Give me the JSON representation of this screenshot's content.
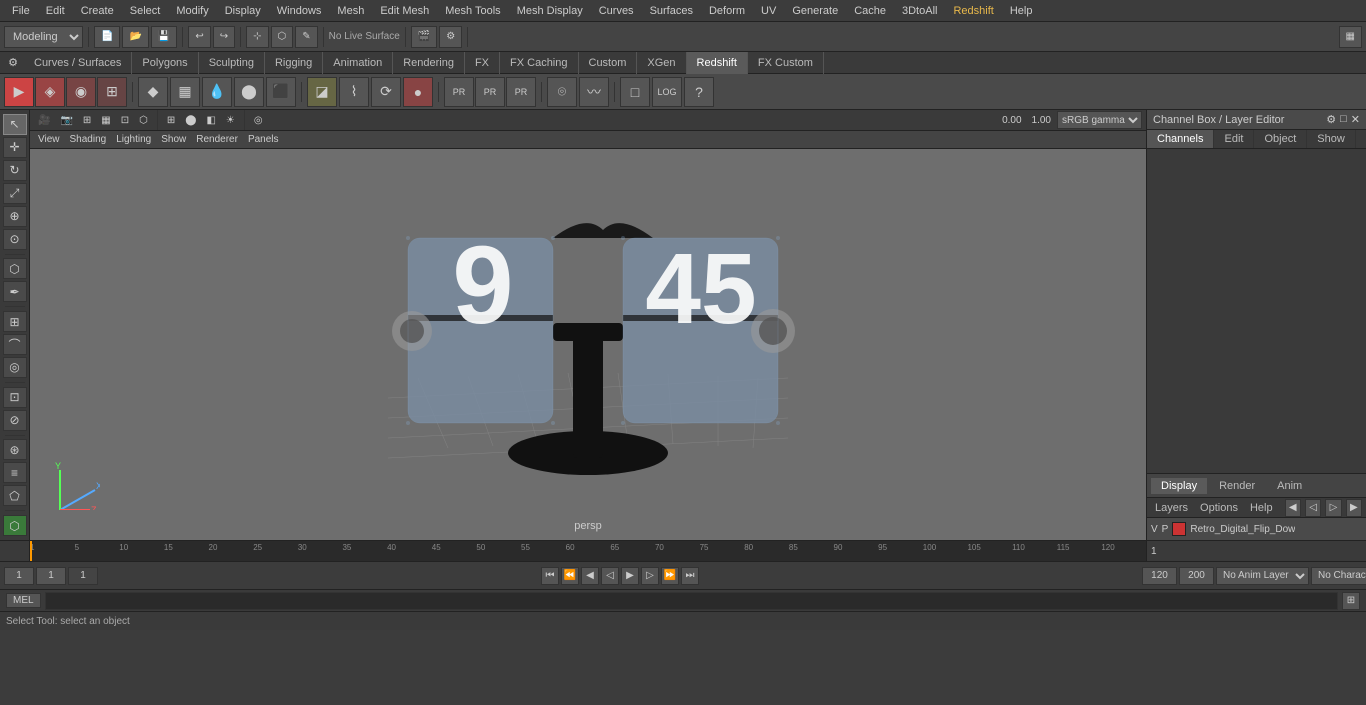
{
  "menubar": {
    "items": [
      "File",
      "Edit",
      "Create",
      "Select",
      "Modify",
      "Display",
      "Windows",
      "Mesh",
      "Edit Mesh",
      "Mesh Tools",
      "Mesh Display",
      "Curves",
      "Surfaces",
      "Deform",
      "UV",
      "Generate",
      "Cache",
      "3DtoAll",
      "Redshift",
      "Help"
    ]
  },
  "toolbar1": {
    "mode": "Modeling",
    "buttons": [
      "new",
      "open",
      "save",
      "undo",
      "redo"
    ]
  },
  "shelf": {
    "tabs": [
      "Curves / Surfaces",
      "Polygons",
      "Sculpting",
      "Rigging",
      "Animation",
      "Rendering",
      "FX",
      "FX Caching",
      "Custom",
      "XGen",
      "Redshift",
      "FX Custom"
    ],
    "active_tab": "Redshift"
  },
  "viewport_menus": {
    "items": [
      "View",
      "Shading",
      "Lighting",
      "Show",
      "Renderer",
      "Panels"
    ]
  },
  "viewport": {
    "label": "persp",
    "gamma": "sRGB gamma",
    "coord_x": "0.00",
    "coord_y": "1.00"
  },
  "channel_box": {
    "title": "Channel Box / Layer Editor",
    "tabs": [
      "Channels",
      "Edit",
      "Object",
      "Show"
    ]
  },
  "layer_editor": {
    "tabs": [
      "Display",
      "Render",
      "Anim"
    ],
    "active_tab": "Display",
    "menus": [
      "Layers",
      "Options",
      "Help"
    ],
    "layer_name": "Retro_Digital_Flip_Dow",
    "layer_v": "V",
    "layer_p": "P"
  },
  "timeline": {
    "start": 1,
    "end": 120,
    "current": 1,
    "ticks": [
      1,
      5,
      10,
      15,
      20,
      25,
      30,
      35,
      40,
      45,
      50,
      55,
      60,
      65,
      70,
      75,
      80,
      85,
      90,
      95,
      100,
      105,
      110,
      115,
      120
    ]
  },
  "playback": {
    "current_frame": "1",
    "start_frame": "1",
    "end_frame": "120",
    "anim_end": "120",
    "range_end": "200",
    "anim_layer": "No Anim Layer",
    "char_set": "No Character Set",
    "buttons": [
      "jump_start",
      "prev_key",
      "prev_frame",
      "play_back",
      "play_fwd",
      "next_frame",
      "next_key",
      "jump_end"
    ]
  },
  "status_bar": {
    "language": "MEL",
    "command_placeholder": "",
    "status_text": "Select Tool: select an object"
  },
  "icons": {
    "arrow": "▶",
    "arrow_left": "◀",
    "play": "▶",
    "pause": "⏸",
    "jump_start": "⏮",
    "jump_end": "⏭",
    "prev_frame": "◀",
    "next_frame": "▶",
    "close": "✕",
    "gear": "⚙",
    "maximize": "□"
  }
}
